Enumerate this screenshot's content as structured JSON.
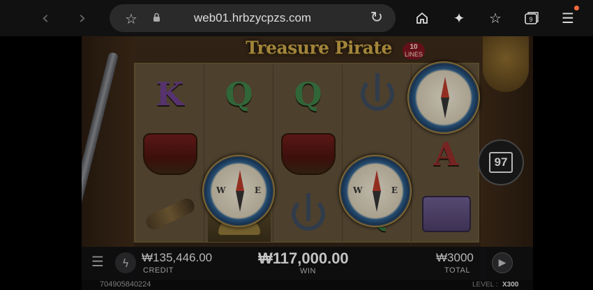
{
  "browser": {
    "url": "web01.hrbzycpzs.com",
    "tab_count": "9",
    "icons": [
      "back-icon",
      "forward-icon",
      "star-icon",
      "lock-icon",
      "reload-icon",
      "home-icon",
      "sparkle-icon",
      "favorites-icon",
      "tabs-icon",
      "menu-icon"
    ]
  },
  "game": {
    "title": "Treasure Pirate",
    "lines_count": "10",
    "lines_label": "LINES",
    "spin_counter": "97",
    "reels": [
      [
        "K",
        "ship",
        "spyglass"
      ],
      [
        "Q",
        "compass",
        "gold"
      ],
      [
        "Q",
        "ship",
        "anchor"
      ],
      [
        "anchor",
        "compass",
        "Q"
      ],
      [
        "compass",
        "A",
        "map"
      ]
    ],
    "compass_letters": {
      "west": "W",
      "east": "E"
    }
  },
  "hud": {
    "credit_value": "₩135,446.00",
    "credit_label": "CREDIT",
    "win_value": "₩117,000.00",
    "win_label": "WIN",
    "total_value": "₩3000",
    "total_label": "TOTAL"
  },
  "footer": {
    "round_id": "704905840224",
    "level_label": "LEVEL :",
    "level_value": "X300"
  }
}
